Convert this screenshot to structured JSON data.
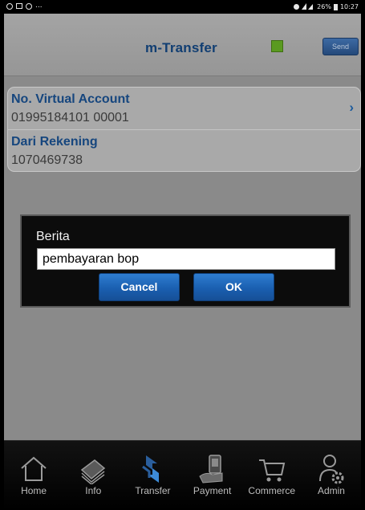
{
  "statusbar": {
    "ellipsis": "...",
    "right_text": "26%",
    "time": "10:27"
  },
  "header": {
    "title": "m-Transfer",
    "send_label": "Send",
    "status_color": "#5a9a20"
  },
  "form": {
    "rows": [
      {
        "label": "No. Virtual Account",
        "value": "01995184101 00001",
        "chevron": "›"
      },
      {
        "label": "Dari Rekening",
        "value": "1070469738"
      }
    ]
  },
  "dialog": {
    "label": "Berita",
    "input_value": "pembayaran bop",
    "cancel_label": "Cancel",
    "ok_label": "OK"
  },
  "tabs": [
    {
      "label": "Home",
      "icon": "home-icon"
    },
    {
      "label": "Info",
      "icon": "info-icon"
    },
    {
      "label": "Transfer",
      "icon": "transfer-icon"
    },
    {
      "label": "Payment",
      "icon": "payment-icon"
    },
    {
      "label": "Commerce",
      "icon": "cart-icon"
    },
    {
      "label": "Admin",
      "icon": "admin-icon"
    }
  ],
  "colors": {
    "accent": "#113e72",
    "label_blue": "#16467e",
    "button_blue": "#1a5fb0"
  }
}
